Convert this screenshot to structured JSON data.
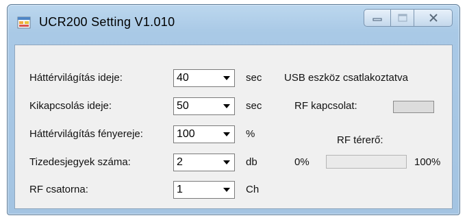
{
  "window": {
    "title": "UCR200  Setting  V1.010",
    "icon": "app-window-icon",
    "caption_buttons": [
      "minimize-icon",
      "maximize-icon",
      "close-icon"
    ]
  },
  "settings": [
    {
      "label": "Háttérvilágítás ideje:",
      "value": "40",
      "unit": "sec"
    },
    {
      "label": "Kikapcsolás ideje:",
      "value": "50",
      "unit": "sec"
    },
    {
      "label": "Háttérvilágítás fényereje:",
      "value": "100",
      "unit": "%"
    },
    {
      "label": "Tizedesjegyek száma:",
      "value": "2",
      "unit": "db"
    },
    {
      "label": "RF csatorna:",
      "value": "1",
      "unit": "Ch"
    }
  ],
  "status": {
    "usb": "USB eszköz csatlakoztatva",
    "rf_connection_label": "RF kapcsolat:",
    "rf_strength_label": "RF térerő:",
    "min_label": "0%",
    "max_label": "100%",
    "rf_strength_value": 0
  },
  "colors": {
    "progress_fill": "#06b025",
    "indicator": "#dcdcdc"
  }
}
